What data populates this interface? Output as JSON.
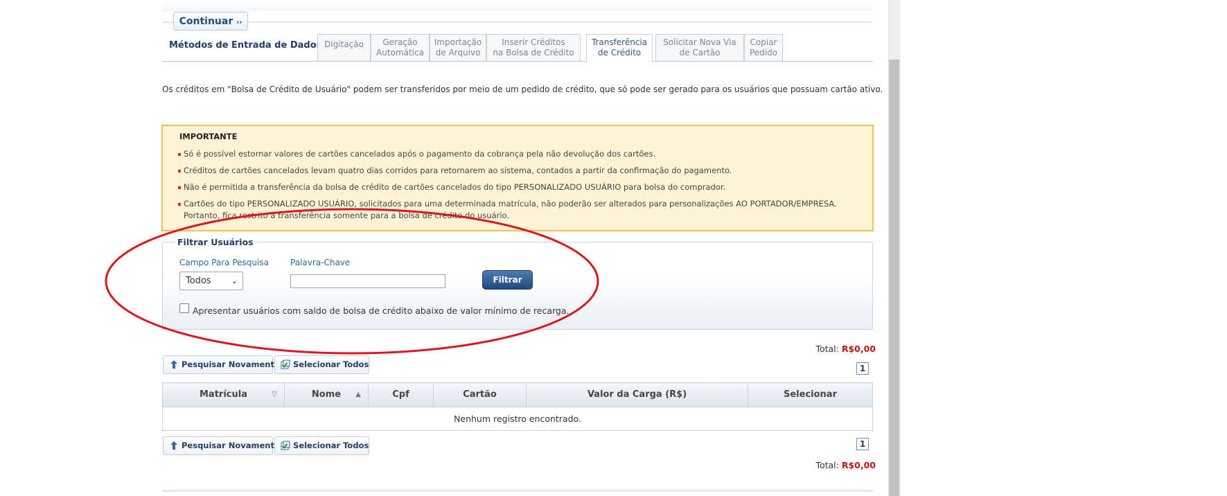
{
  "top": {
    "continue_label": "Continuar",
    "continue_arrow": "››"
  },
  "tabs": {
    "section_label": "Métodos de Entrada de Dados",
    "items": [
      {
        "line1": "Digitação",
        "line2": ""
      },
      {
        "line1": "Geração",
        "line2": "Automática"
      },
      {
        "line1": "Importação",
        "line2": "de Arquivo"
      },
      {
        "line1": "Inserir Créditos",
        "line2": "na Bolsa de Crédito"
      },
      {
        "line1": "Transferência",
        "line2": "de Crédito"
      },
      {
        "line1": "Solicitar Nova Via",
        "line2": "de Cartão"
      },
      {
        "line1": "Copiar",
        "line2": "Pedido"
      }
    ],
    "active_index": 4
  },
  "description": "Os créditos em \"Bolsa de Crédito de Usuário\" podem ser transferidos por meio de um pedido de crédito, que só pode ser gerado para os usuários que possuam cartão ativo.",
  "important": {
    "title": "IMPORTANTE",
    "items": [
      "Só é possível estornar valores de cartões cancelados após o pagamento da cobrança pela não devolução dos cartões.",
      "Créditos de cartões cancelados levam quatro dias corridos para retornarem ao sistema, contados a partir da confirmação do pagamento.",
      "Não é permitida a transferência da bolsa de crédito de cartões cancelados do tipo PERSONALIZADO USUÁRIO para bolsa do comprador.",
      "Cartões do tipo PERSONALIZADO USUÁRIO, solicitados para uma determinada matrícula, não poderão ser alterados para personalizações AO PORTADOR/EMPRESA.",
      "Portanto, fica restrito a transferência somente para a bolsa de crédito do usuário."
    ]
  },
  "filter": {
    "legend": "Filtrar Usuários",
    "campo_label": "Campo Para Pesquisa",
    "campo_value": "Todos",
    "palavra_label": "Palavra-Chave",
    "palavra_value": "",
    "filter_button": "Filtrar",
    "checkbox_label": "Apresentar usuários com saldo de bolsa de crédito abaixo de valor mínimo de recarga.",
    "checkbox_checked": false
  },
  "results": {
    "total_label": "Total:",
    "total_value": "R$0,00",
    "search_again": "Pesquisar Novamente",
    "select_all": "Selecionar Todos",
    "page": "1",
    "columns": [
      "Matrícula",
      "Nome",
      "Cpf",
      "Cartão",
      "Valor da Carga (R$)",
      "Selecionar"
    ],
    "empty_message": "Nenhum registro encontrado."
  },
  "colors": {
    "accent": "#1f4a80",
    "warning_bg": "#fff4d6",
    "warning_border": "#f1c34a",
    "total_red": "#c0140f",
    "annotation": "#e0141e"
  }
}
